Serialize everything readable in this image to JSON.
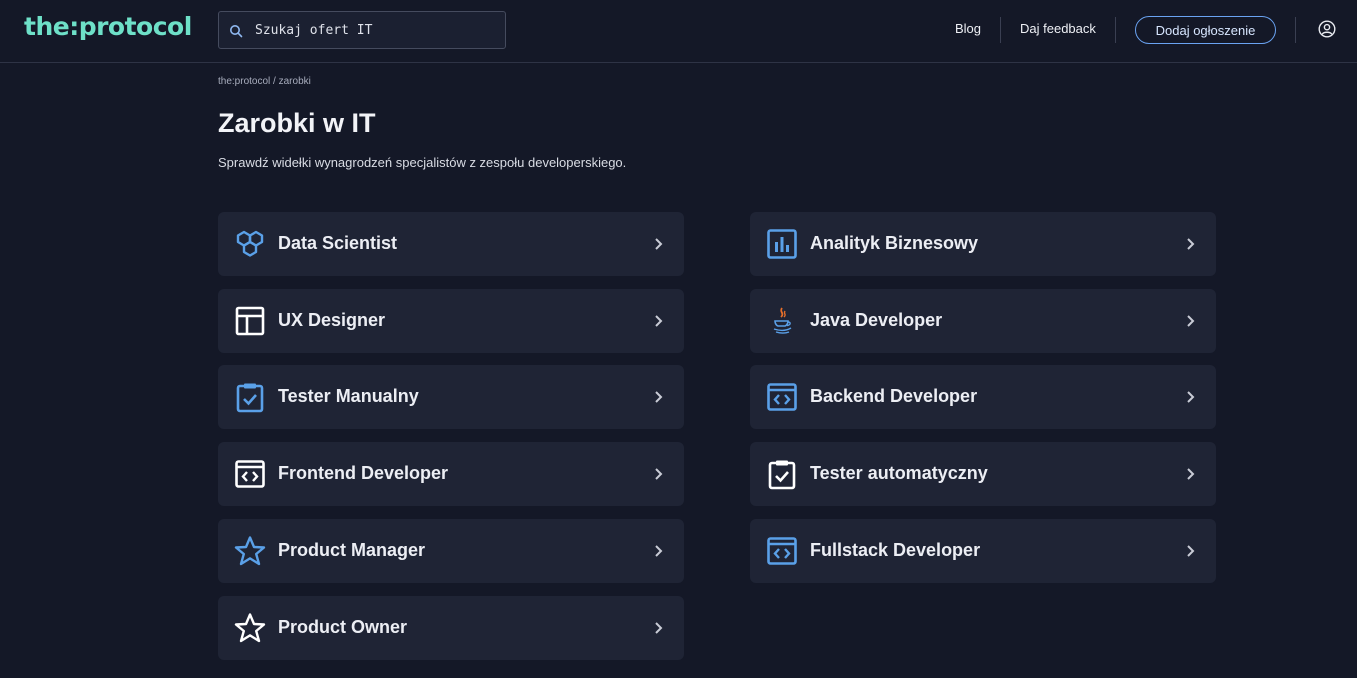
{
  "header": {
    "logo": "the:protocol",
    "search_placeholder": "Szukaj ofert IT",
    "blog": "Blog",
    "feedback": "Daj feedback",
    "add_offer": "Dodaj ogłoszenie"
  },
  "breadcrumb": {
    "home": "the:protocol",
    "separator": "/",
    "current": "zarobki"
  },
  "page": {
    "title": "Zarobki w IT",
    "subtitle": "Sprawdź widełki wynagrodzeń specjalistów z zespołu developerskiego."
  },
  "roles": [
    {
      "label": "Data Scientist",
      "icon": "hexagon-cluster-icon"
    },
    {
      "label": "Analityk Biznesowy",
      "icon": "bar-chart-icon"
    },
    {
      "label": "UX Designer",
      "icon": "layout-icon"
    },
    {
      "label": "Java Developer",
      "icon": "java-cup-icon"
    },
    {
      "label": "Tester Manualny",
      "icon": "clipboard-check-icon"
    },
    {
      "label": "Backend Developer",
      "icon": "code-window-icon"
    },
    {
      "label": "Frontend Developer",
      "icon": "code-window-icon"
    },
    {
      "label": "Tester automatyczny",
      "icon": "clipboard-check-icon"
    },
    {
      "label": "Product Manager",
      "icon": "star-icon"
    },
    {
      "label": "Fullstack Developer",
      "icon": "code-window-icon"
    },
    {
      "label": "Product Owner",
      "icon": "star-icon"
    }
  ],
  "colors": {
    "background": "#141827",
    "card": "#1f2435",
    "accent_blue": "#5aa0e8",
    "logo": "#6ee0c8",
    "icon_white": "#ffffff"
  }
}
